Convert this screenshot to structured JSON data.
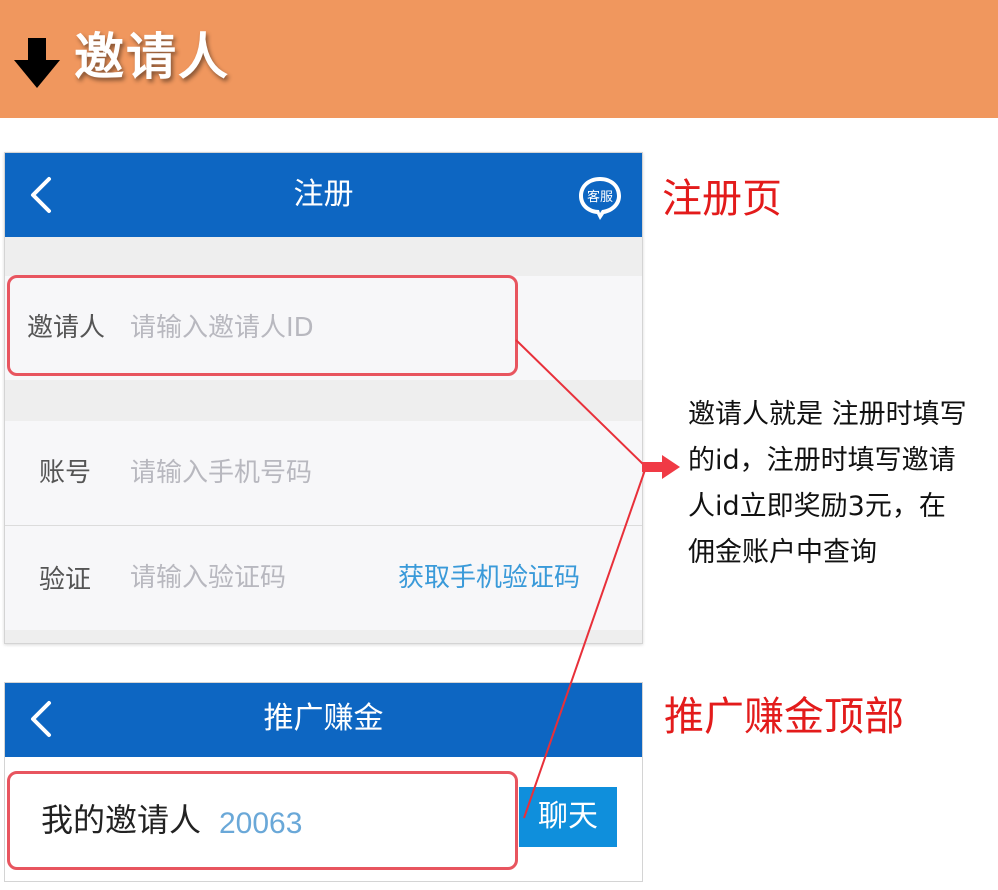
{
  "banner": {
    "title": "邀请人",
    "arrow_icon": "arrow-down-icon",
    "color": "#f0975e"
  },
  "register_screen": {
    "nav": {
      "title": "注册",
      "back_icon": "chevron-left-icon",
      "service_icon": "customer-service-icon",
      "service_label": "客服",
      "color": "#0d66c2"
    },
    "inviter": {
      "label": "邀请人",
      "placeholder": "请输入邀请人ID"
    },
    "account": {
      "label": "账号",
      "placeholder": "请输入手机号码"
    },
    "verify": {
      "label": "验证",
      "placeholder": "请输入验证码",
      "link": "获取手机验证码"
    }
  },
  "promo_screen": {
    "nav": {
      "title": "推广赚金",
      "back_icon": "chevron-left-icon"
    },
    "my_inviter_label": "我的邀请人",
    "my_inviter_id": "20063",
    "chat_button": "聊天"
  },
  "annotations": {
    "register_page": "注册页",
    "promo_top": "推广赚金顶部",
    "explanation": "邀请人就是 注册时填写\n的id，注册时填写邀请\n人id立即奖励3元，在\n佣金账户中查询",
    "highlight_color": "#e8555f",
    "text_color": "#e31b1b"
  }
}
